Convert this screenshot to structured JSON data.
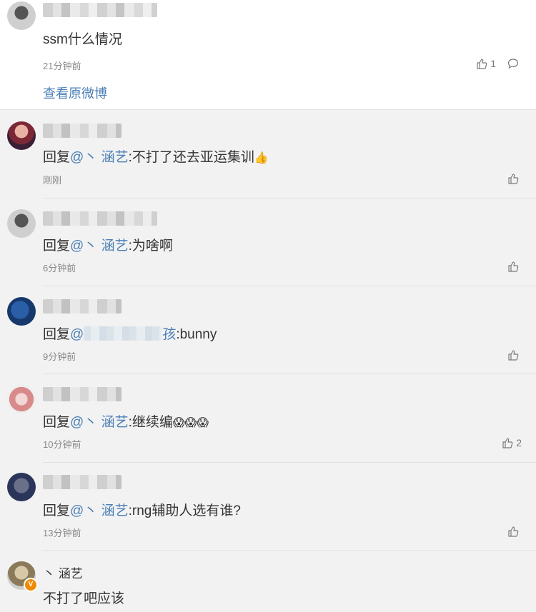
{
  "top": {
    "text": "ssm什么情况",
    "time": "21分钟前",
    "like_count": "1",
    "link": "查看原微博"
  },
  "replies": [
    {
      "prefix": "回复",
      "mention": "@丶 涵艺",
      "body": ":不打了还去亚运集训",
      "emoji": "👍",
      "time": "刚刚",
      "like_count": ""
    },
    {
      "prefix": "回复",
      "mention": "@丶 涵艺",
      "body": ":为啥啊",
      "time": "6分钟前",
      "like_count": ""
    },
    {
      "prefix": "回复",
      "mention": "@",
      "mention_tail": "孩",
      "body": ":bunny",
      "time": "9分钟前",
      "like_count": ""
    },
    {
      "prefix": "回复",
      "mention": "@丶 涵艺",
      "body": ":继续编",
      "emoji": "😱😱😱",
      "time": "10分钟前",
      "like_count": "2"
    },
    {
      "prefix": "回复",
      "mention": "@丶 涵艺",
      "body": ":rng辅助人选有谁?",
      "time": "13分钟前",
      "like_count": ""
    }
  ],
  "last": {
    "name": "丶 涵艺",
    "text": "不打了吧应该",
    "badge": "V"
  },
  "colors": {
    "link": "#4c7fb6",
    "badge": "#f08a00"
  }
}
